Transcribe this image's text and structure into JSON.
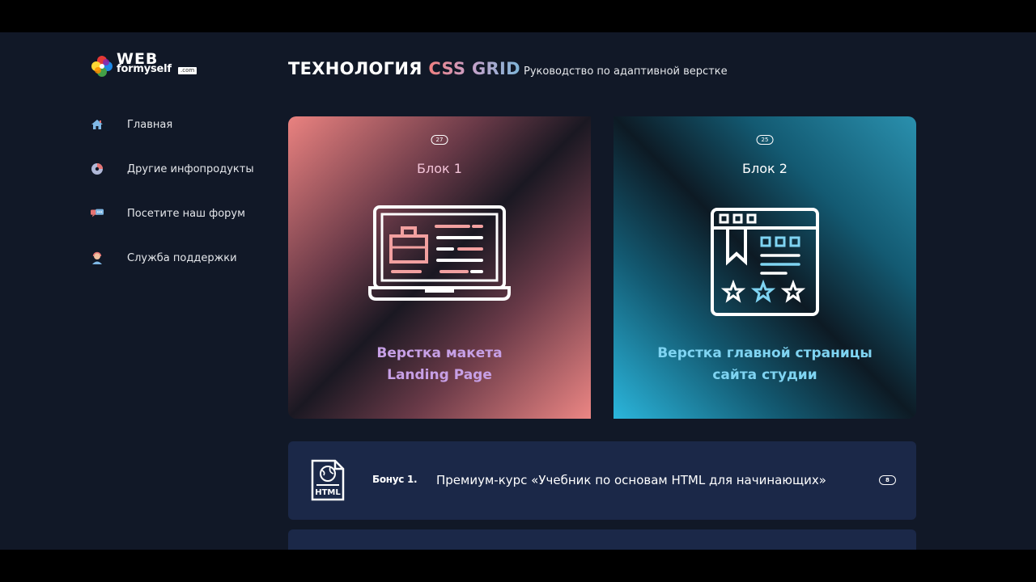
{
  "logo": {
    "web": "WEB",
    "formyself": "formyself",
    "com": ".com"
  },
  "header": {
    "title_part1": "ТЕХНОЛОГИЯ",
    "title_part2": "CSS GRID",
    "subtitle": "Руководство по адаптивной верстке"
  },
  "sidebar": {
    "items": [
      {
        "label": "Главная",
        "icon": "home-icon"
      },
      {
        "label": "Другие инфопродукты",
        "icon": "disc-icon"
      },
      {
        "label": "Посетите наш форум",
        "icon": "chat-icon"
      },
      {
        "label": "Служба поддержки",
        "icon": "support-agent-icon"
      }
    ]
  },
  "cards": [
    {
      "badge": "27",
      "label": "Блок 1",
      "text_line1": "Верстка макета",
      "text_line2": "Landing Page",
      "icon": "laptop-layout-icon"
    },
    {
      "badge": "25",
      "label": "Блок 2",
      "text_line1": "Верстка главной страницы",
      "text_line2": "сайта студии",
      "icon": "browser-rating-icon"
    }
  ],
  "bonuses": [
    {
      "number": "Бонус 1.",
      "title": "Премиум-курс «Учебник по основам HTML для начинающих»",
      "badge": "8",
      "icon": "html-file-icon"
    }
  ],
  "colors": {
    "background": "#111827",
    "bonus_row": "#1b2848",
    "card1_accent": "#ea8280",
    "card2_accent": "#2bb6dc"
  }
}
